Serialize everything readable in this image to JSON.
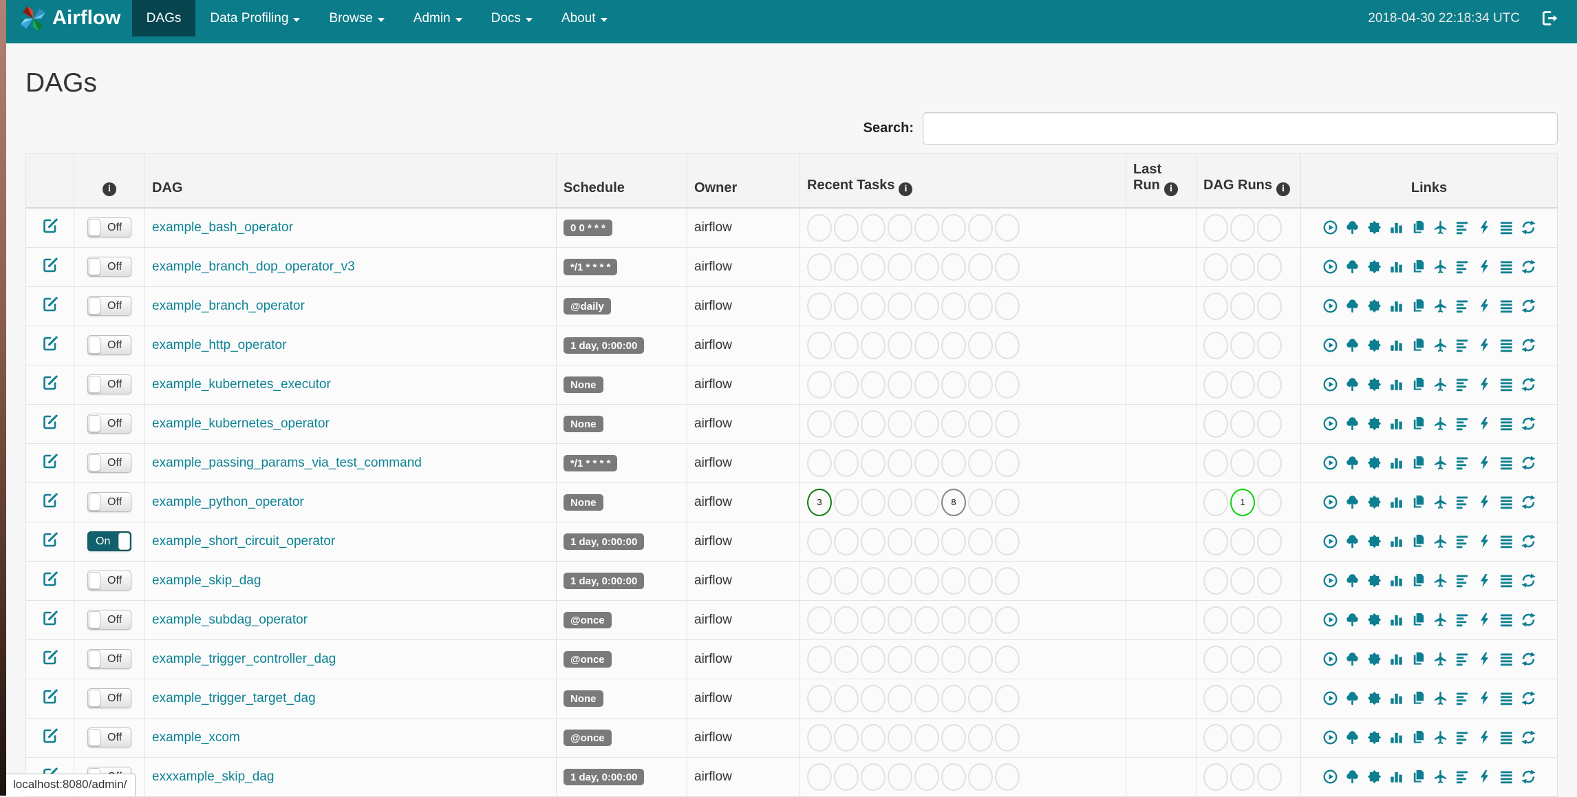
{
  "colors": {
    "accent": "#0d8394",
    "navbar": "#0b7c89",
    "navbar_active": "#07454e",
    "badge_bg": "#7a7a7a",
    "ring_default": "#e1e1e1",
    "state_success": "#0f7c0f",
    "state_running": "#09d309",
    "state_queued": "#848484",
    "toggle_on_bg": "#10616d"
  },
  "navbar": {
    "brand": "Airflow",
    "items": [
      {
        "label": "DAGs",
        "active": true,
        "dropdown": false
      },
      {
        "label": "Data Profiling",
        "active": false,
        "dropdown": true
      },
      {
        "label": "Browse",
        "active": false,
        "dropdown": true
      },
      {
        "label": "Admin",
        "active": false,
        "dropdown": true
      },
      {
        "label": "Docs",
        "active": false,
        "dropdown": true
      },
      {
        "label": "About",
        "active": false,
        "dropdown": true
      }
    ],
    "clock": "2018-04-30 22:18:34 UTC"
  },
  "page": {
    "title": "DAGs"
  },
  "search": {
    "label": "Search:",
    "value": ""
  },
  "table": {
    "headers": {
      "edit": "",
      "info": "",
      "dag": "DAG",
      "schedule": "Schedule",
      "owner": "Owner",
      "recent_tasks": "Recent Tasks",
      "last_run": "Last Run",
      "dag_runs": "DAG Runs",
      "links": "Links"
    },
    "recent_task_slots": 8,
    "dag_run_slots": 3,
    "rows": [
      {
        "dag_id": "example_bash_operator",
        "toggle": "Off",
        "schedule": "0 0 * * *",
        "owner": "airflow",
        "last_run": "",
        "recent_tasks": [],
        "dag_runs": []
      },
      {
        "dag_id": "example_branch_dop_operator_v3",
        "toggle": "Off",
        "schedule": "*/1 * * * *",
        "owner": "airflow",
        "last_run": "",
        "recent_tasks": [],
        "dag_runs": []
      },
      {
        "dag_id": "example_branch_operator",
        "toggle": "Off",
        "schedule": "@daily",
        "owner": "airflow",
        "last_run": "",
        "recent_tasks": [],
        "dag_runs": []
      },
      {
        "dag_id": "example_http_operator",
        "toggle": "Off",
        "schedule": "1 day, 0:00:00",
        "owner": "airflow",
        "last_run": "",
        "recent_tasks": [],
        "dag_runs": []
      },
      {
        "dag_id": "example_kubernetes_executor",
        "toggle": "Off",
        "schedule": "None",
        "owner": "airflow",
        "last_run": "",
        "recent_tasks": [],
        "dag_runs": []
      },
      {
        "dag_id": "example_kubernetes_operator",
        "toggle": "Off",
        "schedule": "None",
        "owner": "airflow",
        "last_run": "",
        "recent_tasks": [],
        "dag_runs": []
      },
      {
        "dag_id": "example_passing_params_via_test_command",
        "toggle": "Off",
        "schedule": "*/1 * * * *",
        "owner": "airflow",
        "last_run": "",
        "recent_tasks": [],
        "dag_runs": []
      },
      {
        "dag_id": "example_python_operator",
        "toggle": "Off",
        "schedule": "None",
        "owner": "airflow",
        "last_run": "",
        "recent_tasks": [
          {
            "slot": 0,
            "count": 3,
            "state": "success"
          },
          {
            "slot": 5,
            "count": 8,
            "state": "queued"
          }
        ],
        "dag_runs": [
          {
            "slot": 1,
            "count": 1,
            "state": "running"
          }
        ]
      },
      {
        "dag_id": "example_short_circuit_operator",
        "toggle": "On",
        "schedule": "1 day, 0:00:00",
        "owner": "airflow",
        "last_run": "",
        "recent_tasks": [],
        "dag_runs": []
      },
      {
        "dag_id": "example_skip_dag",
        "toggle": "Off",
        "schedule": "1 day, 0:00:00",
        "owner": "airflow",
        "last_run": "",
        "recent_tasks": [],
        "dag_runs": []
      },
      {
        "dag_id": "example_subdag_operator",
        "toggle": "Off",
        "schedule": "@once",
        "owner": "airflow",
        "last_run": "",
        "recent_tasks": [],
        "dag_runs": []
      },
      {
        "dag_id": "example_trigger_controller_dag",
        "toggle": "Off",
        "schedule": "@once",
        "owner": "airflow",
        "last_run": "",
        "recent_tasks": [],
        "dag_runs": []
      },
      {
        "dag_id": "example_trigger_target_dag",
        "toggle": "Off",
        "schedule": "None",
        "owner": "airflow",
        "last_run": "",
        "recent_tasks": [],
        "dag_runs": []
      },
      {
        "dag_id": "example_xcom",
        "toggle": "Off",
        "schedule": "@once",
        "owner": "airflow",
        "last_run": "",
        "recent_tasks": [],
        "dag_runs": []
      },
      {
        "dag_id": "exxxample_skip_dag",
        "toggle": "Off",
        "schedule": "1 day, 0:00:00",
        "owner": "airflow",
        "last_run": "",
        "recent_tasks": [],
        "dag_runs": []
      }
    ]
  },
  "links_icons": [
    "trigger-dag-icon",
    "tree-view-icon",
    "graph-view-icon",
    "task-duration-icon",
    "task-tries-icon",
    "landing-times-icon",
    "gantt-view-icon",
    "code-view-icon",
    "logs-icon",
    "refresh-icon"
  ],
  "status_bar": {
    "text": "localhost:8080/admin/"
  }
}
